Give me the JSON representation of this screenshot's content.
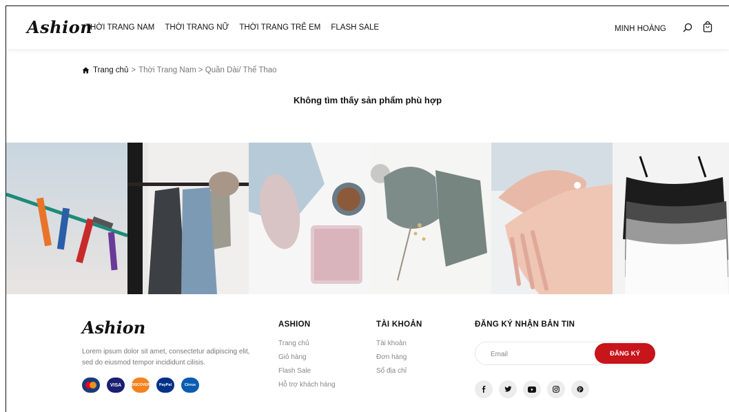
{
  "header": {
    "logo": "Ashion",
    "nav": [
      "THỜI TRANG NAM",
      "THỜI TRANG NỮ",
      "THỜI TRANG TRẺ EM",
      "FLASH SALE"
    ],
    "user": "MINH HOÀNG"
  },
  "breadcrumb": {
    "home": "Trang chủ",
    "sep": ">",
    "path": "Thời Trang Nam > Quần Dài/ Thể Thao"
  },
  "main": {
    "empty_message": "Không tìm thấy sản phẩm phù hợp"
  },
  "footer": {
    "logo": "Ashion",
    "description": "Lorem ipsum dolor sit amet, consectetur adipiscing elit, sed do eiusmod tempor incididunt cilisis.",
    "payment_cards": [
      {
        "label": "",
        "color": "#1a3b7a"
      },
      {
        "label": "VISA",
        "color": "#1a1f71"
      },
      {
        "label": "DISCOVER",
        "color": "#f5821f"
      },
      {
        "label": "PayPal",
        "color": "#003087"
      },
      {
        "label": "Cirrus",
        "color": "#0a5cb0"
      }
    ],
    "columns": [
      {
        "title": "ASHION",
        "links": [
          "Trang chủ",
          "Giỏ hàng",
          "Flash Sale",
          "Hỗ trợ khách hàng"
        ]
      },
      {
        "title": "TÀI KHOẢN",
        "links": [
          "Tài khoản",
          "Đơn hàng",
          "Sổ địa chỉ"
        ]
      }
    ],
    "newsletter": {
      "title": "ĐĂNG KÝ NHẬN BẢN TIN",
      "placeholder": "Email",
      "button": "ĐĂNG KÝ"
    },
    "socials": [
      {
        "icon": "facebook-icon",
        "glyph": "f"
      },
      {
        "icon": "twitter-icon",
        "glyph": "t"
      },
      {
        "icon": "youtube-icon",
        "glyph": "▶"
      },
      {
        "icon": "instagram-icon",
        "glyph": "◎"
      },
      {
        "icon": "pinterest-icon",
        "glyph": "p"
      }
    ]
  },
  "colors": {
    "accent": "#c8141b"
  }
}
